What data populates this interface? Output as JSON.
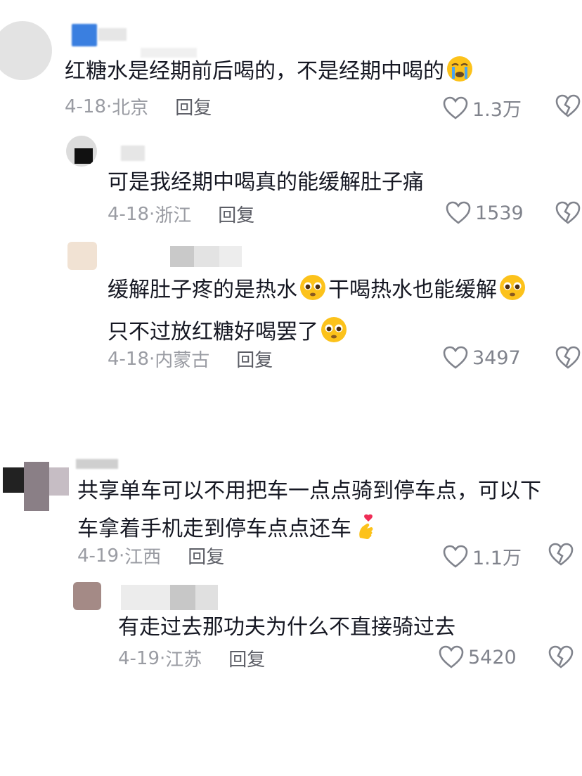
{
  "comments": [
    {
      "text_lines": [
        "红糖水是经期前后喝的，不是经期中喝的"
      ],
      "emoji": "loudly-crying-emoji",
      "date": "4-18",
      "location": "北京",
      "reply_label": "回复",
      "likes": "1.3万"
    },
    {
      "text_lines": [
        "可是我经期中喝真的能缓解肚子痛"
      ],
      "date": "4-18",
      "location": "浙江",
      "reply_label": "回复",
      "likes": "1539"
    },
    {
      "text_lines": [
        "缓解肚子疼的是热水",
        "干喝热水也能缓解",
        "只不过放红糖好喝罢了"
      ],
      "emoji": "pleading-face-emoji",
      "date": "4-18",
      "location": "内蒙古",
      "reply_label": "回复",
      "likes": "3497"
    },
    {
      "text_lines": [
        "共享单车可以不用把车一点点骑到停车点，可以下",
        "车拿着手机走到停车点点还车"
      ],
      "emoji": "finger-heart-emoji",
      "date": "4-19",
      "location": "江西",
      "reply_label": "回复",
      "likes": "1.1万"
    },
    {
      "text_lines": [
        "有走过去那功夫为什么不直接骑过去"
      ],
      "date": "4-19",
      "location": "江苏",
      "reply_label": "回复",
      "likes": "5420"
    }
  ],
  "meta_separator": "·",
  "colors": {
    "text": "#161823",
    "meta": "#9a9ca3",
    "like_icon": "#80838c"
  },
  "icons": {
    "like": "heart-outline-icon",
    "dislike": "broken-heart-icon"
  }
}
